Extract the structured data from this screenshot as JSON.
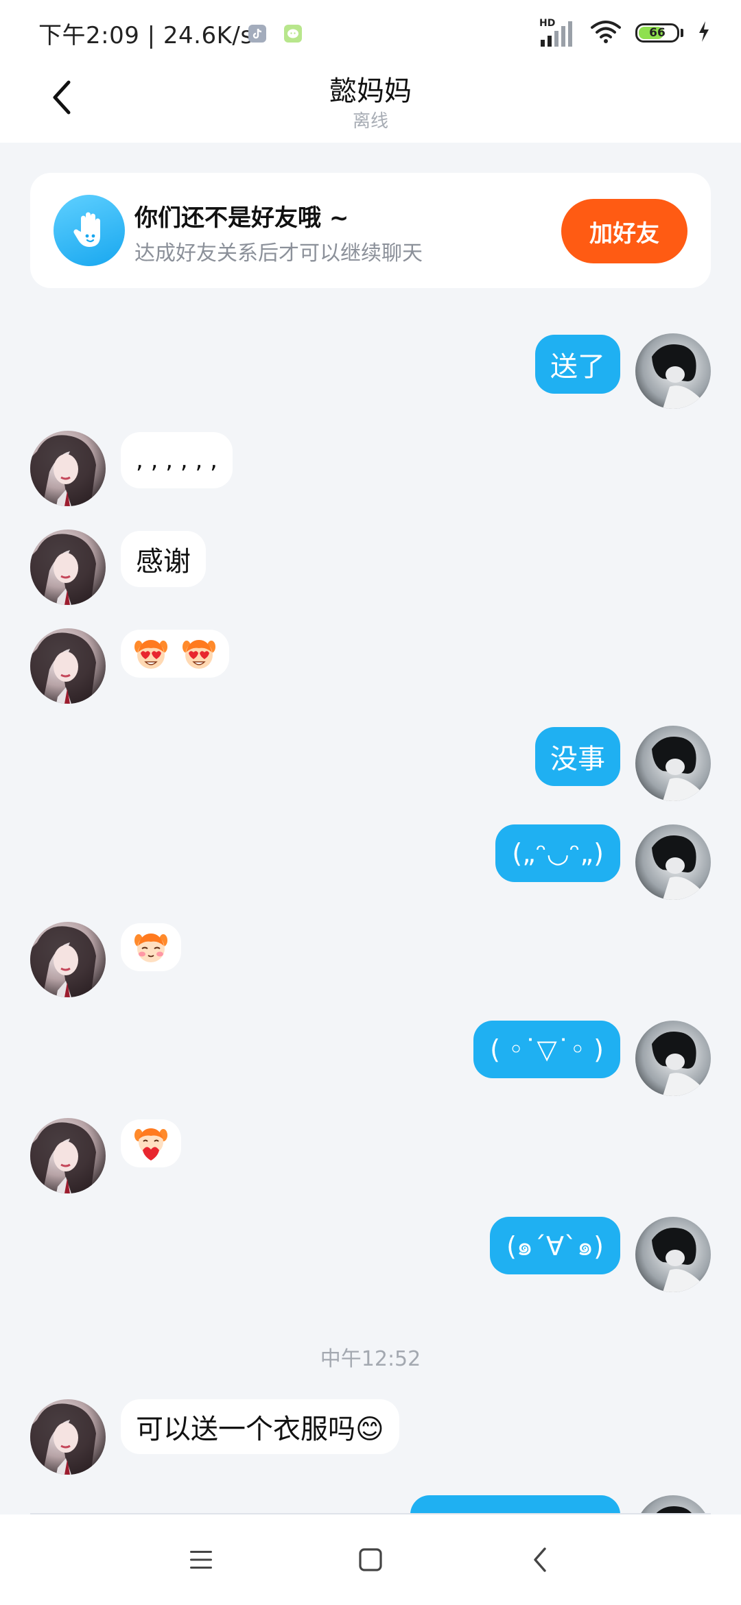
{
  "status_bar": {
    "time": "下午2:09 | 24.6K/s",
    "network_label": "HD",
    "battery_level": "66",
    "battery_fraction": 0.66,
    "icons": [
      "douyin-app-icon",
      "wechat-app-icon",
      "signal-icon",
      "wifi-icon",
      "battery-icon",
      "charging-icon"
    ]
  },
  "header": {
    "title": "懿妈妈",
    "status": "离线"
  },
  "friend_banner": {
    "title": "你们还不是好友哦 ~",
    "subtitle": "达成好友关系后才可以继续聊天",
    "button": "加好友",
    "icon": "waving-hand-icon"
  },
  "messages": [
    {
      "sender": "self",
      "text": "送了"
    },
    {
      "sender": "other",
      "text": ", , , , , ,"
    },
    {
      "sender": "other",
      "text": "感谢"
    },
    {
      "sender": "other",
      "text": "",
      "emoji": [
        "heart-eyes-emoji",
        "heart-eyes-emoji"
      ]
    },
    {
      "sender": "self",
      "text": "没事"
    },
    {
      "sender": "self",
      "text": "(„ᵔ◡ᵔ„)"
    },
    {
      "sender": "other",
      "text": "",
      "emoji": [
        "blushing-face-emoji"
      ]
    },
    {
      "sender": "self",
      "text": "( ◦˙▽˙◦ )"
    },
    {
      "sender": "other",
      "text": "",
      "emoji": [
        "heart-hug-emoji"
      ]
    },
    {
      "sender": "self",
      "text": "(๑´∀`๑)"
    },
    {
      "sender": "other",
      "text": "可以送一个衣服吗😊"
    }
  ],
  "time_divider": "中午12:52",
  "bottom_nav": {
    "icons": [
      "menu-icon",
      "home-icon",
      "back-icon"
    ]
  },
  "colors": {
    "self_bubble": "#1fb0f2",
    "other_bubble": "#ffffff",
    "add_friend_button": "#ff5b13",
    "background": "#f3f5f8"
  }
}
